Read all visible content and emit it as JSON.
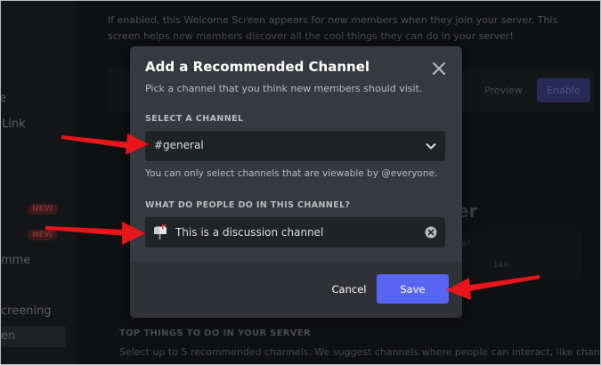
{
  "background": {
    "description": "If enabled, this Welcome Screen appears for new members when they join your server. This screen helps new members discover all the cool things they can do in your server!",
    "sidebar_items": [
      "e",
      "Link",
      "mme",
      "creening",
      "en"
    ],
    "badge_new": "NEW",
    "preview_label": "Preview",
    "enable_label": "Enable",
    "big_text": "er",
    "panel_text_1": "e?",
    "panel_text_2": "146",
    "top_things_heading": "TOP THINGS TO DO IN YOUR SERVER",
    "top_things_desc": "Select up to 5 recommended channels. We suggest channels where people can interact, like channels for"
  },
  "modal": {
    "title": "Add a Recommended Channel",
    "subtitle": "Pick a channel that you think new members should visit.",
    "select_label": "SELECT A CHANNEL",
    "selected_channel": "#general",
    "helper_text": "You can only select channels that are viewable by @everyone.",
    "description_label": "WHAT DO PEOPLE DO IN THIS CHANNEL?",
    "description_value": "This is a discussion channel",
    "emoji_icon": "mailbox-icon",
    "cancel_label": "Cancel",
    "save_label": "Save"
  },
  "colors": {
    "modal_bg": "#36393f",
    "footer_bg": "#2f3136",
    "input_bg": "#202225",
    "accent": "#5865f2",
    "annotation": "#e8151b"
  }
}
